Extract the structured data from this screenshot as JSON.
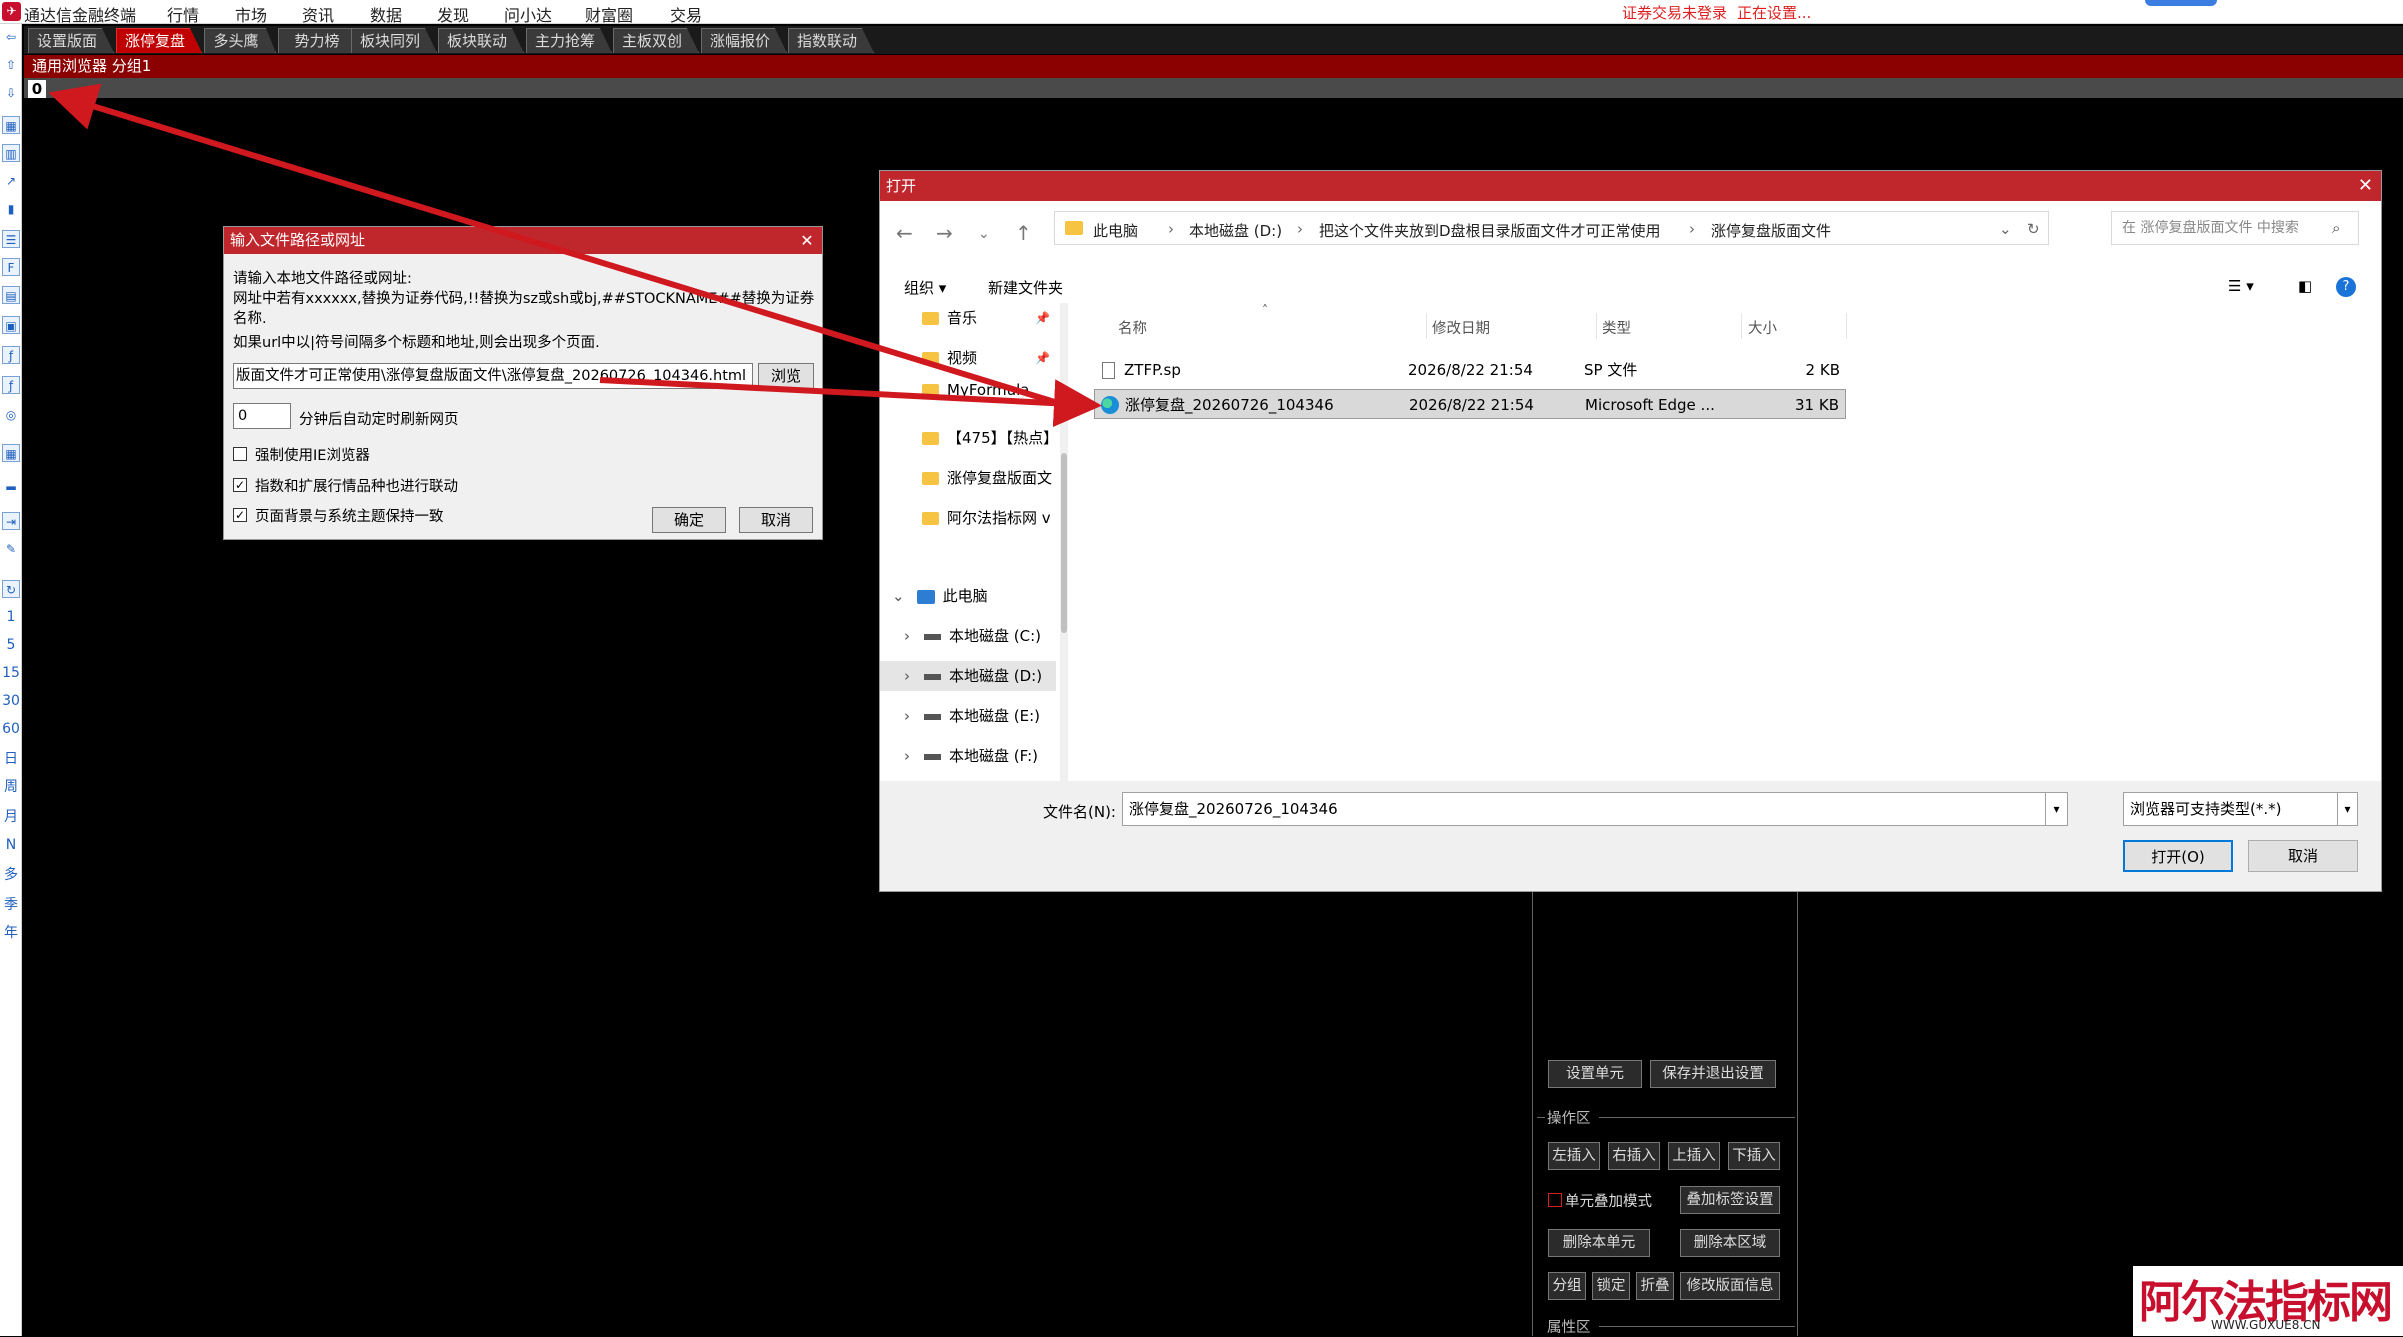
{
  "menubar": {
    "app_title": "通达信金融终端",
    "items": [
      "行情",
      "市场",
      "资讯",
      "数据",
      "发现",
      "问小达",
      "财富圈",
      "交易"
    ],
    "status_login": "证券交易未登录",
    "status_setting": "正在设置..."
  },
  "tabs": [
    {
      "label": "设置版面",
      "active": false
    },
    {
      "label": "涨停复盘",
      "active": true
    },
    {
      "label": "多头鹰",
      "active": false
    },
    {
      "label": "势力榜",
      "active": false
    },
    {
      "label": "板块同列",
      "active": false
    },
    {
      "label": "板块联动",
      "active": false
    },
    {
      "label": "主力抢筹",
      "active": false
    },
    {
      "label": "主板双创",
      "active": false
    },
    {
      "label": "涨幅报价",
      "active": false
    },
    {
      "label": "指数联动",
      "active": false
    }
  ],
  "browser_bar": {
    "title": "通用浏览器 分组1",
    "zero": "0"
  },
  "left_toolbar": {
    "periods": [
      "1",
      "5",
      "15",
      "30",
      "60",
      "日",
      "周",
      "月",
      "N",
      "多",
      "季",
      "年"
    ]
  },
  "input_dialog": {
    "title": "输入文件路径或网址",
    "line1": "请输入本地文件路径或网址:",
    "line2": "网址中若有xxxxxx,替换为证券代码,!!替换为sz或sh或bj,##STOCKNAME##替换为证券",
    "line3": "名称.",
    "line4": "如果url中以|符号间隔多个标题和地址,则会出现多个页面.",
    "path_value": "版面文件才可正常使用\\涨停复盘版面文件\\涨停复盘_20260726_104346.html",
    "browse": "浏览",
    "refresh_value": "0",
    "refresh_label": "分钟后自动定时刷新网页",
    "cb_ie": {
      "label": "强制使用IE浏览器",
      "checked": false
    },
    "cb_link": {
      "label": "指数和扩展行情品种也进行联动",
      "checked": true
    },
    "cb_theme": {
      "label": "页面背景与系统主题保持一致",
      "checked": true
    },
    "ok": "确定",
    "cancel": "取消"
  },
  "open_dialog": {
    "title": "打开",
    "breadcrumbs": [
      "此电脑",
      "本地磁盘 (D:)",
      "把这个文件夹放到D盘根目录版面文件才可正常使用",
      "涨停复盘版面文件"
    ],
    "search_placeholder": "在 涨停复盘版面文件 中搜索",
    "organize": "组织 ▾",
    "new_folder": "新建文件夹",
    "nav": {
      "items": [
        {
          "label": "音乐",
          "kind": "folder",
          "pinned": true
        },
        {
          "label": "视频",
          "kind": "folder",
          "pinned": true
        },
        {
          "label": "MyFormula",
          "kind": "folder",
          "pinned": false
        },
        {
          "label": "【475】【热点】",
          "kind": "folder",
          "pinned": false
        },
        {
          "label": "涨停复盘版面文",
          "kind": "folder",
          "pinned": false
        },
        {
          "label": "阿尔法指标网 v",
          "kind": "folder",
          "pinned": false
        }
      ],
      "pc": "此电脑",
      "drives": [
        {
          "label": "本地磁盘 (C:)",
          "selected": false
        },
        {
          "label": "本地磁盘 (D:)",
          "selected": true
        },
        {
          "label": "本地磁盘 (E:)",
          "selected": false
        },
        {
          "label": "本地磁盘 (F:)",
          "selected": false
        }
      ]
    },
    "columns": {
      "name": "名称",
      "date": "修改日期",
      "type": "类型",
      "size": "大小"
    },
    "files": [
      {
        "name": "ZTFP.sp",
        "date": "2026/8/22 21:54",
        "type": "SP 文件",
        "size": "2 KB",
        "icon": "doc",
        "selected": false
      },
      {
        "name": "涨停复盘_20260726_104346",
        "date": "2026/8/22 21:54",
        "type": "Microsoft Edge ...",
        "size": "31 KB",
        "icon": "edge",
        "selected": true
      }
    ],
    "filename_label": "文件名(N):",
    "filename_value": "涨停复盘_20260726_104346",
    "filetype_value": "浏览器可支持类型(*.*)",
    "open_btn": "打开(O)",
    "cancel_btn": "取消"
  },
  "side_panel": {
    "set_unit": "设置单元",
    "save_exit": "保存并退出设置",
    "ops_header": "操作区",
    "insert_left": "左插入",
    "insert_right": "右插入",
    "insert_up": "上插入",
    "insert_down": "下插入",
    "overlay_mode": "单元叠加模式",
    "overlay_tab": "叠加标签设置",
    "delete_unit": "删除本单元",
    "delete_area": "删除本区域",
    "group": "分组",
    "lock": "锁定",
    "fold": "折叠",
    "modify_info": "修改版面信息",
    "props_header": "属性区"
  },
  "watermark": {
    "main": "阿尔法指标网",
    "sub": "WWW.GUXUE8.CN"
  },
  "colors": {
    "brand_red": "#c0272d",
    "tab_active": "#c00000",
    "arrow": "#d0181f",
    "selection_blue": "#0078d7"
  }
}
